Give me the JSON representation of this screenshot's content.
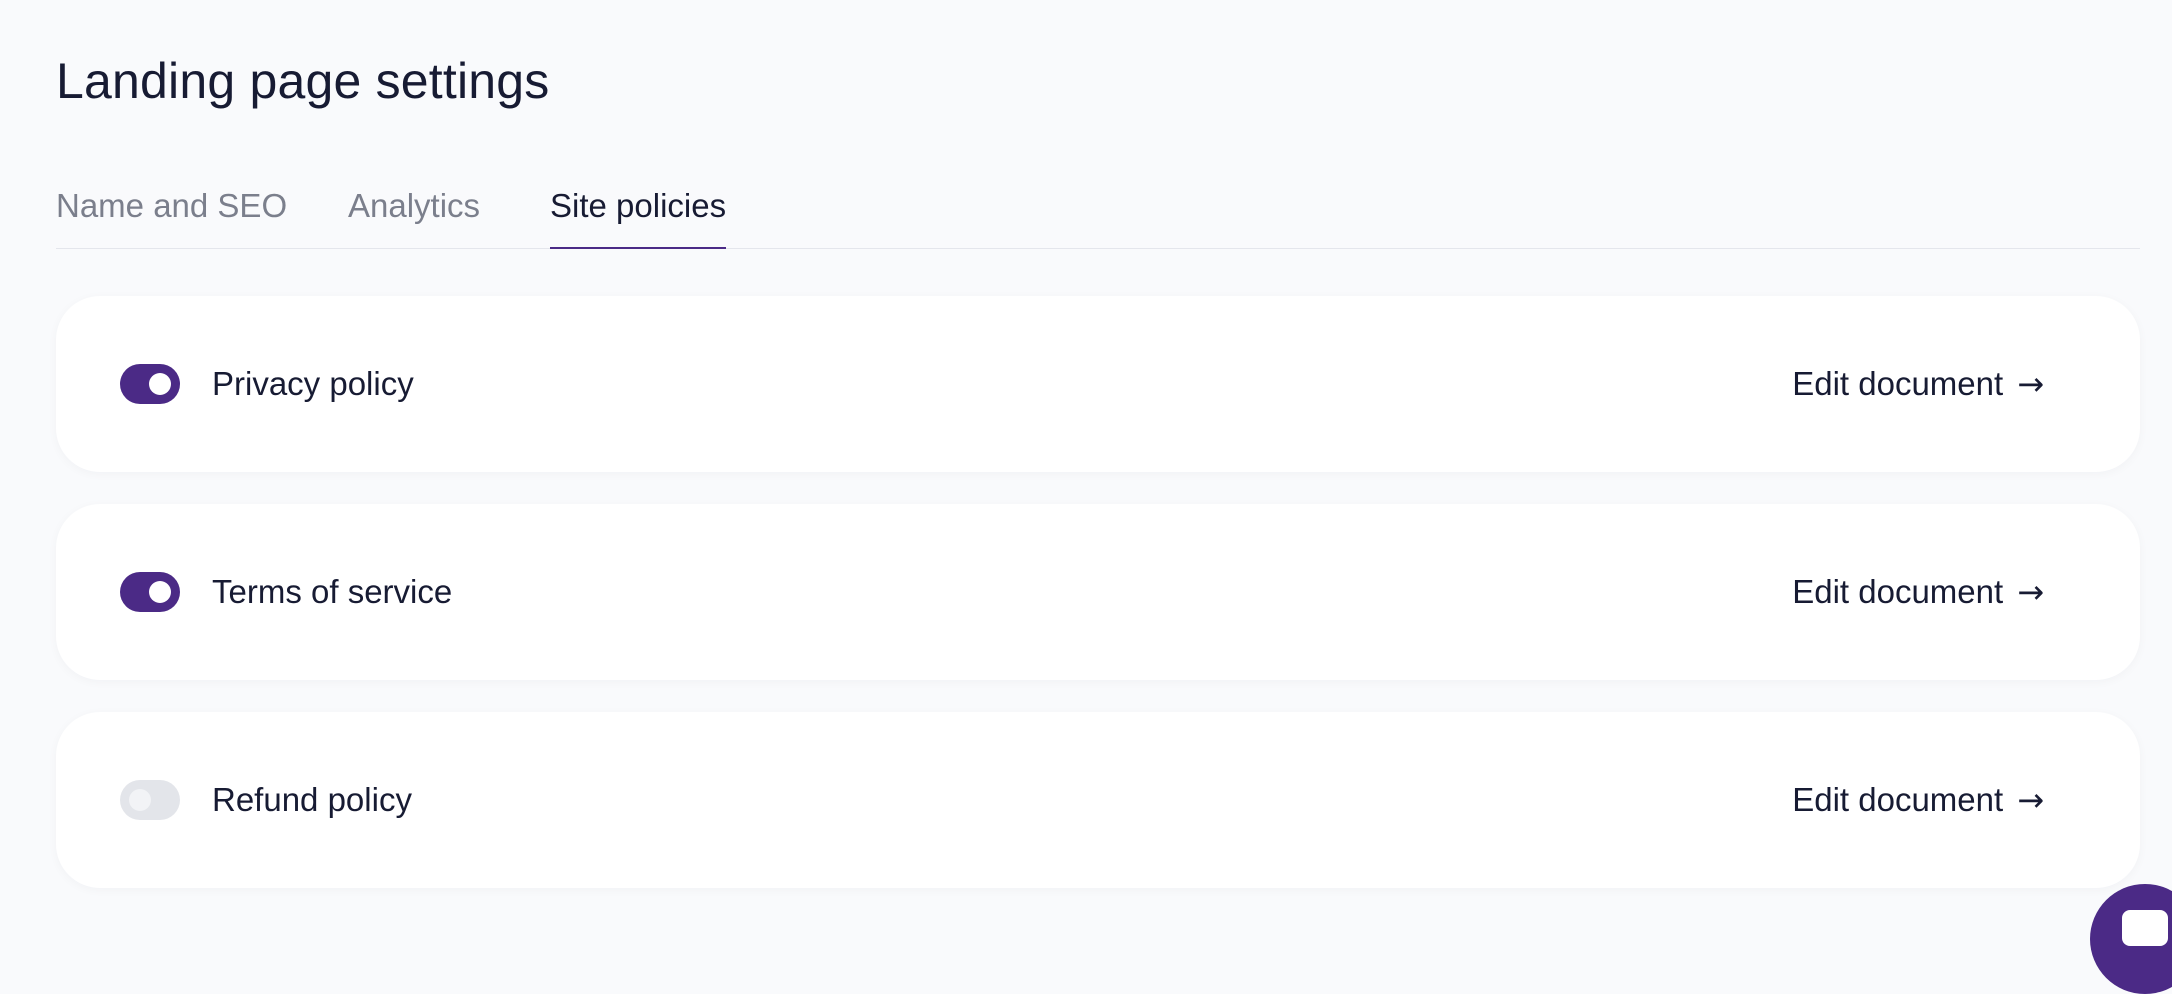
{
  "page": {
    "title": "Landing page settings"
  },
  "tabs": [
    {
      "label": "Name and SEO",
      "active": false
    },
    {
      "label": "Analytics",
      "active": false
    },
    {
      "label": "Site policies",
      "active": true
    }
  ],
  "policies": [
    {
      "name": "Privacy policy",
      "enabled": true,
      "action_label": "Edit document",
      "action_icon": "arrow-right-icon"
    },
    {
      "name": "Terms of service",
      "enabled": true,
      "action_label": "Edit document",
      "action_icon": "arrow-right-icon"
    },
    {
      "name": "Refund policy",
      "enabled": false,
      "action_label": "Edit document",
      "action_icon": "arrow-right-icon"
    }
  ],
  "chat": {
    "icon": "chat-icon"
  },
  "colors": {
    "accent": "#4b2a86",
    "background": "#f9fafc",
    "card": "#ffffff",
    "text_primary": "#171b33",
    "text_muted": "#7b7f8c",
    "toggle_off": "#e3e5ea"
  }
}
